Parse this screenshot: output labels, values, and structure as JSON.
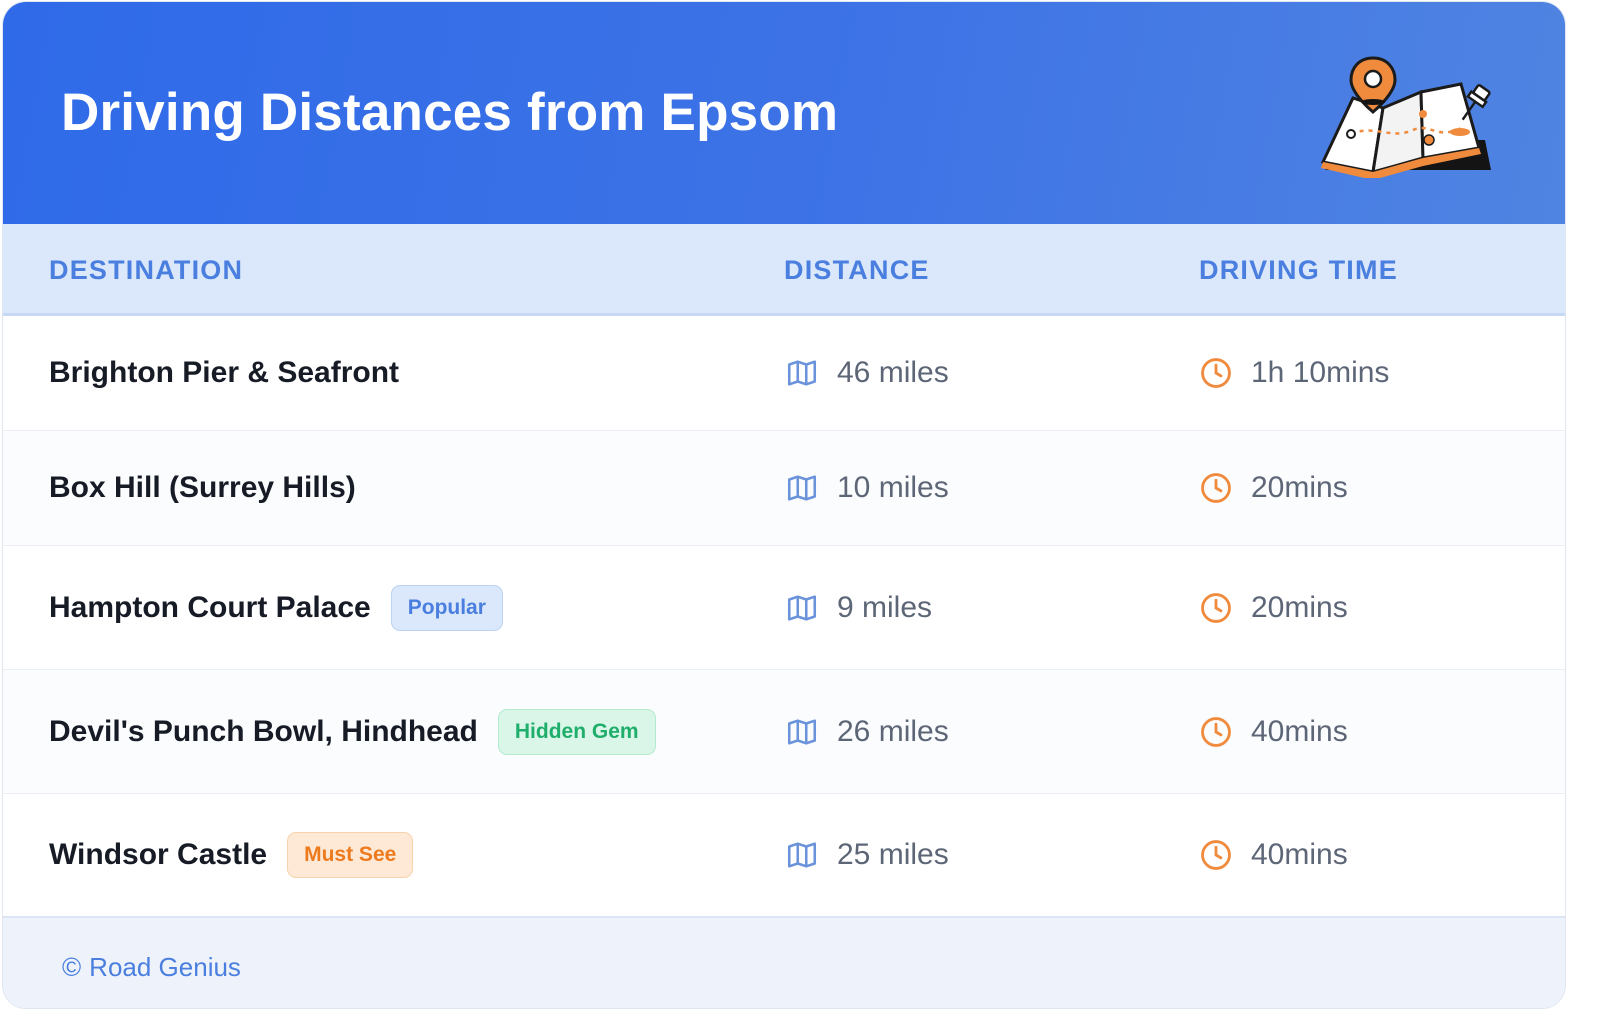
{
  "header": {
    "title": "Driving Distances from Epsom",
    "illustration_icon": "folded-map-with-location-pin-icon"
  },
  "columns": {
    "destination": "DESTINATION",
    "distance": "DISTANCE",
    "driving_time": "DRIVING TIME"
  },
  "rows": [
    {
      "destination": "Brighton Pier & Seafront",
      "badge": "",
      "distance": "46 miles",
      "time": "1h 10mins"
    },
    {
      "destination": "Box Hill (Surrey Hills)",
      "badge": "",
      "distance": "10 miles",
      "time": "20mins"
    },
    {
      "destination": "Hampton Court Palace",
      "badge": "Popular",
      "distance": "9 miles",
      "time": "20mins"
    },
    {
      "destination": "Devil's Punch Bowl, Hindhead",
      "badge": "Hidden Gem",
      "distance": "26 miles",
      "time": "40mins"
    },
    {
      "destination": "Windsor Castle",
      "badge": "Must See",
      "distance": "25 miles",
      "time": "40mins"
    }
  ],
  "footer": {
    "copyright_symbol": "©",
    "credit": "Road Genius"
  },
  "colors": {
    "header_gradient_start": "#2f6ae8",
    "header_gradient_end": "#5084e2",
    "accent_blue": "#4a7fe0",
    "badge_popular": "#4a7fe0",
    "badge_hidden_gem": "#1fae6b",
    "badge_must_see": "#ee7a1e",
    "clock_icon": "#f08a3c"
  },
  "icons": {
    "distance": "map-icon",
    "time": "clock-icon"
  }
}
